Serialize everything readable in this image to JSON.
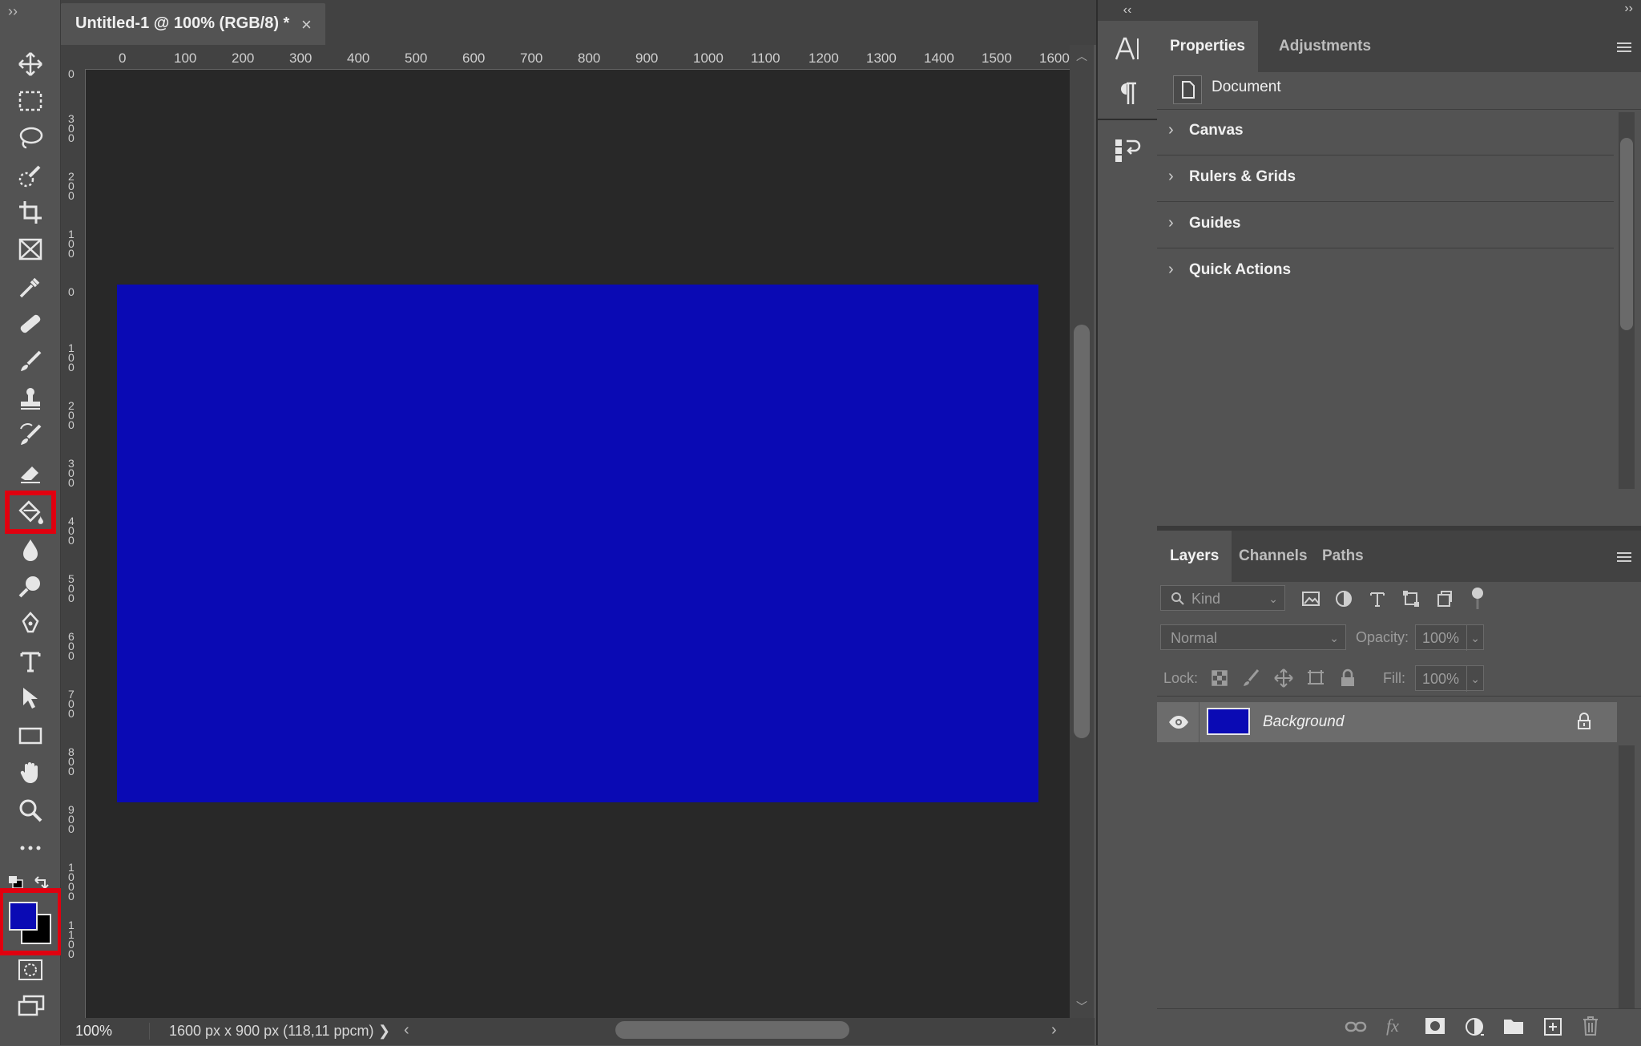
{
  "document_tab": {
    "title": "Untitled-1 @ 100% (RGB/8) *",
    "close": "×"
  },
  "ruler": {
    "h_labels": [
      "0",
      "100",
      "200",
      "300",
      "400",
      "500",
      "600",
      "700",
      "800",
      "900",
      "1000",
      "1100",
      "1200",
      "1300",
      "1400",
      "1500",
      "1600"
    ],
    "v_labels": [
      "0",
      "300",
      "200",
      "100",
      "0",
      "100",
      "200",
      "300",
      "400",
      "500",
      "600",
      "700",
      "800",
      "900",
      "1000",
      "1100"
    ]
  },
  "canvas": {
    "fill_color": "#0a0ab4"
  },
  "status": {
    "zoom": "100%",
    "doc_info": "1600 px x 900 px (118,11 ppcm)",
    "arrow": "❯"
  },
  "toolbar": {
    "grip": "››",
    "foreground_color": "#0a0ab4",
    "background_color": "#000000",
    "tools": [
      "move-tool",
      "rectangular-marquee-tool",
      "lasso-tool",
      "quick-selection-tool",
      "crop-tool",
      "frame-tool",
      "eyedropper-tool",
      "healing-brush-tool",
      "brush-tool",
      "clone-stamp-tool",
      "history-brush-tool",
      "eraser-tool",
      "paint-bucket-tool",
      "blur-tool",
      "dodge-tool",
      "pen-tool",
      "type-tool",
      "path-selection-tool",
      "rectangle-tool",
      "hand-tool",
      "zoom-tool",
      "edit-toolbar"
    ],
    "selected_tool": "paint-bucket-tool"
  },
  "mini_panel": {
    "collapse": "‹‹",
    "expand": "››"
  },
  "properties": {
    "tabs": [
      "Properties",
      "Adjustments"
    ],
    "document_label": "Document",
    "sections": [
      "Canvas",
      "Rulers & Grids",
      "Guides",
      "Quick Actions"
    ]
  },
  "layers": {
    "tabs": [
      "Layers",
      "Channels",
      "Paths"
    ],
    "filter_placeholder": "Kind",
    "blend_mode": "Normal",
    "opacity_label": "Opacity:",
    "opacity_value": "100%",
    "lock_label": "Lock:",
    "fill_label": "Fill:",
    "fill_value": "100%",
    "items": [
      {
        "name": "Background",
        "visible": true,
        "locked": true,
        "thumb_color": "#0a0ab4"
      }
    ]
  },
  "colors": {
    "highlight": "#e0000f",
    "panel_bg": "#535353",
    "dark_bg": "#282828"
  }
}
